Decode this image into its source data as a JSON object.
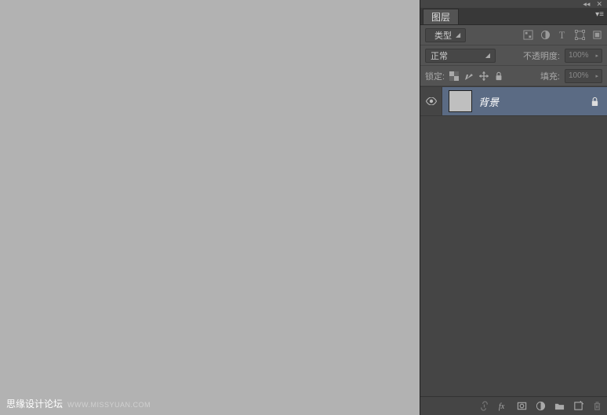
{
  "watermark": {
    "text": "思缘设计论坛",
    "url": "WWW.MISSYUAN.COM"
  },
  "panel": {
    "tab_label": "图层",
    "filter": {
      "label": "类型"
    },
    "blend_mode": {
      "label": "正常"
    },
    "opacity": {
      "label": "不透明度:",
      "value": "100%"
    },
    "lock": {
      "label": "锁定:"
    },
    "fill": {
      "label": "填充:",
      "value": "100%"
    },
    "layers": [
      {
        "name": "背景",
        "visible": true,
        "locked": true
      }
    ]
  }
}
